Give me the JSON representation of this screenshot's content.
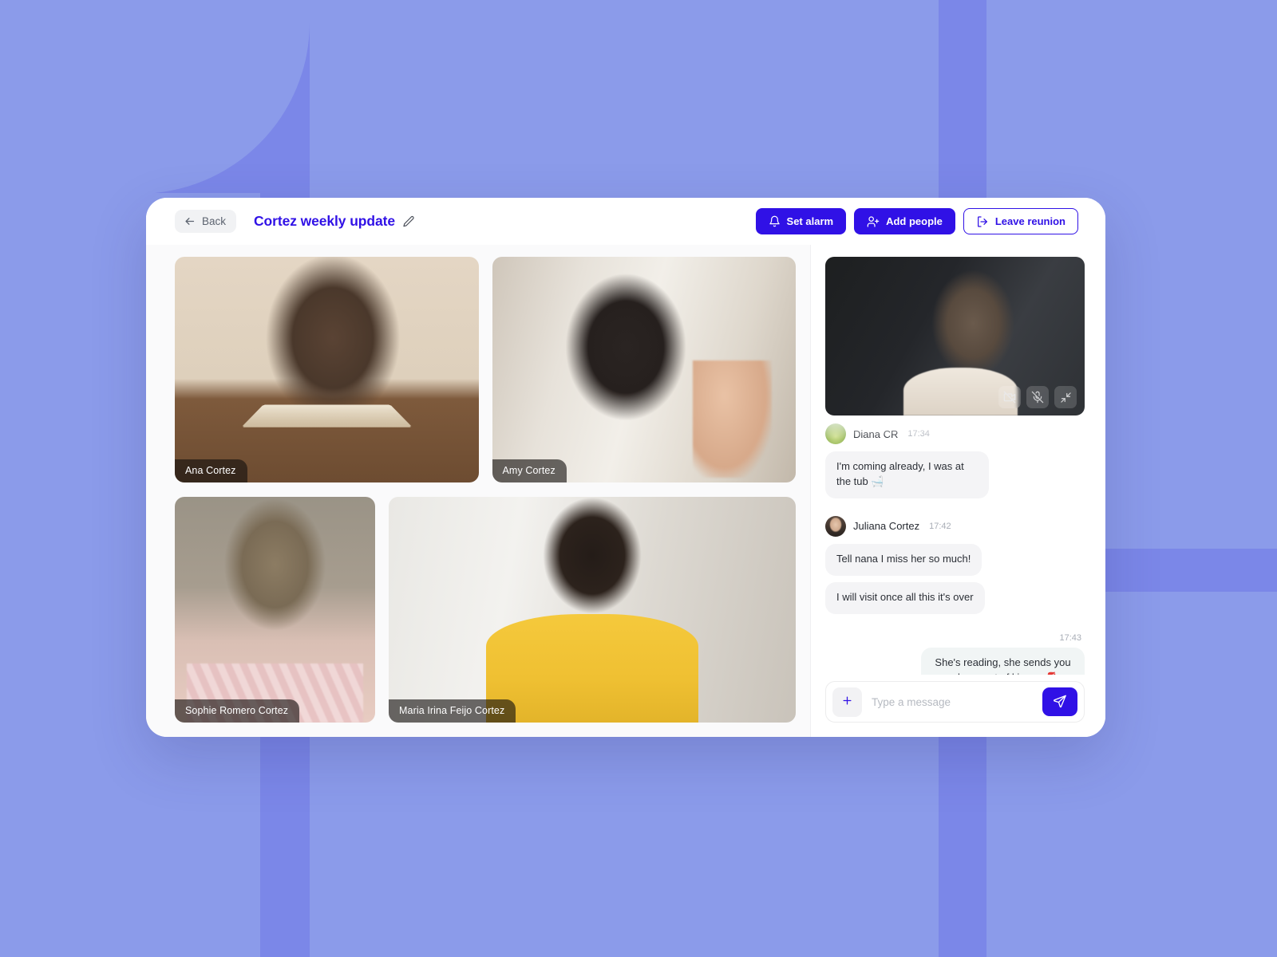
{
  "theme": {
    "primary": "#3011e6",
    "background": "#8b9bea",
    "background_accent": "#7b87e8",
    "card": "#ffffff",
    "body": "#fafafb"
  },
  "header": {
    "back_label": "Back",
    "title": "Cortez weekly update",
    "edit_icon": "pencil-icon",
    "actions": [
      {
        "label": "Set alarm",
        "icon": "bell-icon",
        "style": "primary"
      },
      {
        "label": "Add people",
        "icon": "user-plus-icon",
        "style": "primary"
      },
      {
        "label": "Leave reunion",
        "icon": "logout-icon",
        "style": "outline"
      }
    ]
  },
  "video_grid": {
    "participants": [
      {
        "name": "Ana Cortez",
        "scene": "scene-ana",
        "size": "large"
      },
      {
        "name": "Amy Cortez",
        "scene": "scene-amy",
        "size": "large"
      },
      {
        "name": "Sophie Romero Cortez",
        "scene": "scene-sophie",
        "size": "small"
      },
      {
        "name": "Maria Irina Feijo Cortez",
        "scene": "scene-maria",
        "size": "large"
      }
    ]
  },
  "selfview": {
    "controls": [
      {
        "icon": "camera-off-icon",
        "label": "Turn camera on"
      },
      {
        "icon": "mic-off-icon",
        "label": "Unmute microphone"
      },
      {
        "icon": "minimize-icon",
        "label": "Minimize self view"
      }
    ]
  },
  "chat": {
    "groups": [
      {
        "sender": "Diana CR",
        "time": "17:34",
        "avatar": "diana",
        "faded": true,
        "messages": [
          "I'm coming already, I was at the tub 🛁"
        ]
      },
      {
        "sender": "Juliana Cortez",
        "time": "17:42",
        "avatar": "juliana",
        "faded": false,
        "messages": [
          "Tell nana I miss her so much!",
          "I will visit once all this it's over"
        ]
      }
    ],
    "outgoing": {
      "time": "17:43",
      "text": "She's reading, she sends you a loooooot of kisses 💋"
    },
    "composer": {
      "add_icon": "plus-icon",
      "placeholder": "Type a message",
      "value": "",
      "send_icon": "send-icon"
    }
  }
}
